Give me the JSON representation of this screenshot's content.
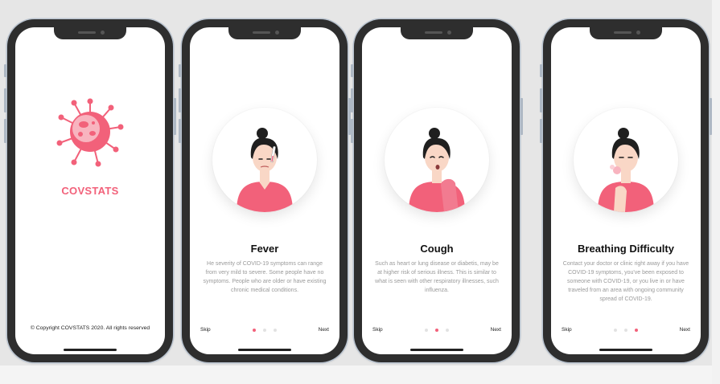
{
  "colors": {
    "accent": "#f2617a",
    "skin": "#f9d7c6",
    "hair": "#1f1f1f",
    "shirt": "#f2617a"
  },
  "splash": {
    "brand": "COVSTATS",
    "logo_icon": "virus-icon",
    "copyright": "© Copyright COVSTATS 2020. All rights reserved"
  },
  "slides": [
    {
      "illustration_icon": "woman-fever-icon",
      "title": "Fever",
      "body": "He severity of COVID-19 symptoms can range from very mild to severe. Some people have no symptoms. People who are older or have existing chronic medical conditions.",
      "skip_label": "Skip",
      "next_label": "Next"
    },
    {
      "illustration_icon": "woman-cough-icon",
      "title": "Cough",
      "body": "Such as heart or lung disease or diabetis, may be at higher risk of serious illness. This is similar to what is seen with other respiratory illnesses, such influenza.",
      "skip_label": "Skip",
      "next_label": "Next"
    },
    {
      "illustration_icon": "woman-breathing-difficulty-icon",
      "title": "Breathing Difficulty",
      "body": "Contact your doctor or clinic right away if you have COVID-19 symptoms, you've been exposed to someone with COVID-19, or you live in or have traveled from an area with ongoing community spread of COVID-19.",
      "skip_label": "Skip",
      "next_label": "Next"
    }
  ]
}
